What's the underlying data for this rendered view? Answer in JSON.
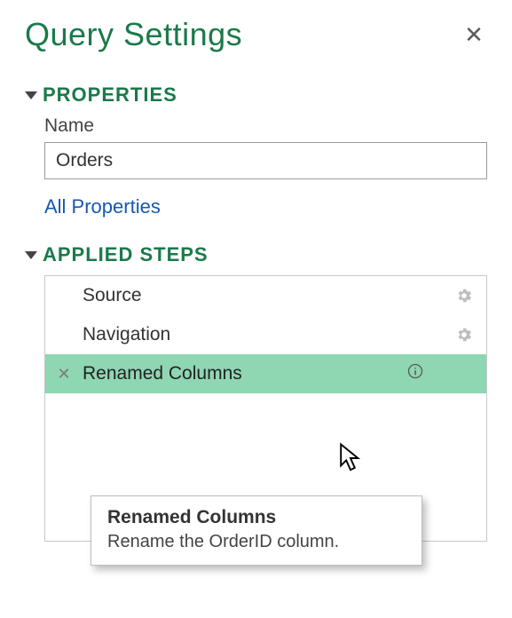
{
  "header": {
    "title": "Query Settings"
  },
  "properties": {
    "section_label": "PROPERTIES",
    "name_label": "Name",
    "name_value": "Orders",
    "all_properties_link": "All Properties"
  },
  "applied_steps": {
    "section_label": "APPLIED STEPS",
    "steps": [
      {
        "label": "Source",
        "has_gear": true,
        "selected": false,
        "deletable": false,
        "has_info": false
      },
      {
        "label": "Navigation",
        "has_gear": true,
        "selected": false,
        "deletable": false,
        "has_info": false
      },
      {
        "label": "Renamed Columns",
        "has_gear": false,
        "selected": true,
        "deletable": true,
        "has_info": true
      }
    ]
  },
  "tooltip": {
    "title": "Renamed Columns",
    "body": "Rename the OrderID column."
  }
}
